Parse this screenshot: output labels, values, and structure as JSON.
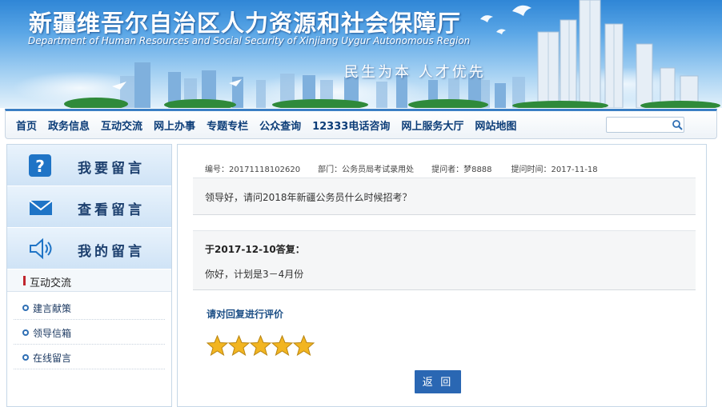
{
  "header": {
    "title": "新疆维吾尔自治区人力资源和社会保障厅",
    "subtitle": "Department of Human Resources and Social Security of Xinjiang Uygur Autonomous Region",
    "slogan": "民生为本   人才优先"
  },
  "nav": {
    "items": [
      "首页",
      "政务信息",
      "互动交流",
      "网上办事",
      "专题专栏",
      "公众查询",
      "12333电话咨询",
      "网上服务大厅",
      "网站地图"
    ],
    "search_placeholder": "",
    "search_icon": "search-icon"
  },
  "sidebar": {
    "buttons": [
      {
        "label": "我要留言",
        "icon": "question-icon"
      },
      {
        "label": "查看留言",
        "icon": "envelope-icon"
      },
      {
        "label": "我的留言",
        "icon": "speaker-icon"
      }
    ],
    "section_title": "互动交流",
    "links": [
      "建言献策",
      "领导信箱",
      "在线留言"
    ]
  },
  "message": {
    "number": "编号：20171118102620",
    "department": "部门：公务员局考试录用处",
    "asker": "提问者：梦8888",
    "time": "提问时间：2017-11-18",
    "question": "领导好，请问2018年新疆公务员什么时候招考？",
    "reply_header": "于2017-12-10答复：",
    "reply_text": "你好，计划是3－4月份",
    "evaluate_label": "请对回复进行评价",
    "rating": 5,
    "rating_max": 5,
    "back_label": "返 回"
  },
  "colors": {
    "nav_text": "#0c3d78",
    "accent_red": "#c0262e",
    "button_blue": "#2a67b3",
    "star_gold": "#f2b521"
  }
}
